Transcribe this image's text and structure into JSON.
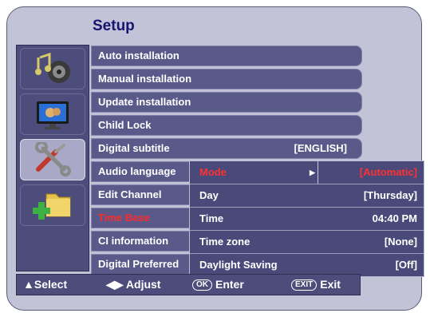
{
  "window": {
    "title": "Setup"
  },
  "sidebar": {
    "icons": [
      {
        "name": "music-speaker-icon"
      },
      {
        "name": "tv-screen-icon"
      },
      {
        "name": "tools-icon"
      },
      {
        "name": "folder-add-icon"
      }
    ]
  },
  "menu": {
    "items": [
      {
        "label": "Auto installation"
      },
      {
        "label": "Manual installation"
      },
      {
        "label": "Update installation"
      },
      {
        "label": "Child Lock"
      },
      {
        "label": "Digital subtitle",
        "value": "[ENGLISH]"
      },
      {
        "label": "Audio language"
      },
      {
        "label": "Edit Channel"
      },
      {
        "label": "Time Base"
      },
      {
        "label": "CI information"
      },
      {
        "label": "Digital Preferred"
      }
    ]
  },
  "submenu": {
    "rows": [
      {
        "label": "Mode",
        "value": "[Automatic]"
      },
      {
        "label": "Day",
        "value": "[Thursday]"
      },
      {
        "label": "Time",
        "value": "04:40 PM"
      },
      {
        "label": "Time zone",
        "value": "[None]"
      },
      {
        "label": "Daylight  Saving",
        "value": "[Off]"
      }
    ]
  },
  "footer": {
    "select_label": "Select",
    "adjust_label": "Adjust",
    "ok_key": "OK",
    "enter_label": "Enter",
    "exit_key": "EXIT",
    "exit_label": "Exit"
  },
  "colors": {
    "panel_bg": "#c3c3d8",
    "item_bg": "#5a5a8a",
    "selected_text": "#ff2a2a",
    "title_text": "#15156e"
  }
}
